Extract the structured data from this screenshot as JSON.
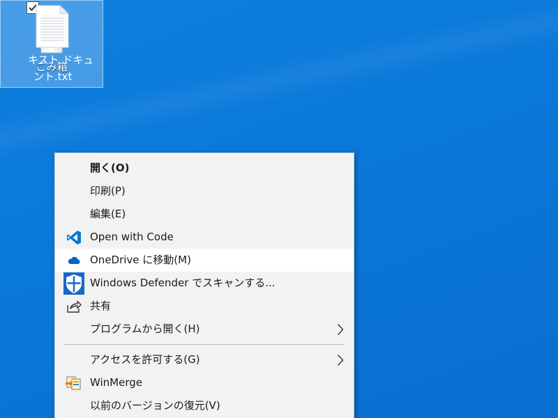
{
  "desktop": {
    "icons": [
      {
        "label": "ごみ箱",
        "icon": "recycle-bin-icon"
      },
      {
        "label_line1": "キスト ドキュ",
        "label_line2": "ント.txt",
        "icon": "text-file-icon",
        "selected": true,
        "checked": true
      }
    ]
  },
  "context_menu": {
    "items": [
      {
        "label": "開く(O)",
        "bold": true,
        "icon": ""
      },
      {
        "label": "印刷(P)",
        "icon": ""
      },
      {
        "label": "編集(E)",
        "icon": ""
      },
      {
        "label": "Open with Code",
        "icon": "vscode-icon"
      },
      {
        "label": "OneDrive に移動(M)",
        "icon": "onedrive-cloud-icon",
        "highlighted": true
      },
      {
        "label": "Windows Defender でスキャンする...",
        "icon": "defender-shield-icon"
      },
      {
        "label": "共有",
        "icon": "share-icon"
      },
      {
        "label": "プログラムから開く(H)",
        "icon": "",
        "submenu": true
      },
      {
        "label": "アクセスを許可する(G)",
        "icon": "",
        "submenu": true
      },
      {
        "label": "WinMerge",
        "icon": "winmerge-icon"
      },
      {
        "label": "以前のバージョンの復元(V)",
        "icon": ""
      }
    ]
  },
  "colors": {
    "desktop_bg": "#0a78d8",
    "menu_bg": "#f2f2f2",
    "menu_hover": "#ffffff",
    "vscode_blue": "#0078d4",
    "onedrive_blue": "#0a64c8",
    "defender_blue": "#1769c6"
  }
}
